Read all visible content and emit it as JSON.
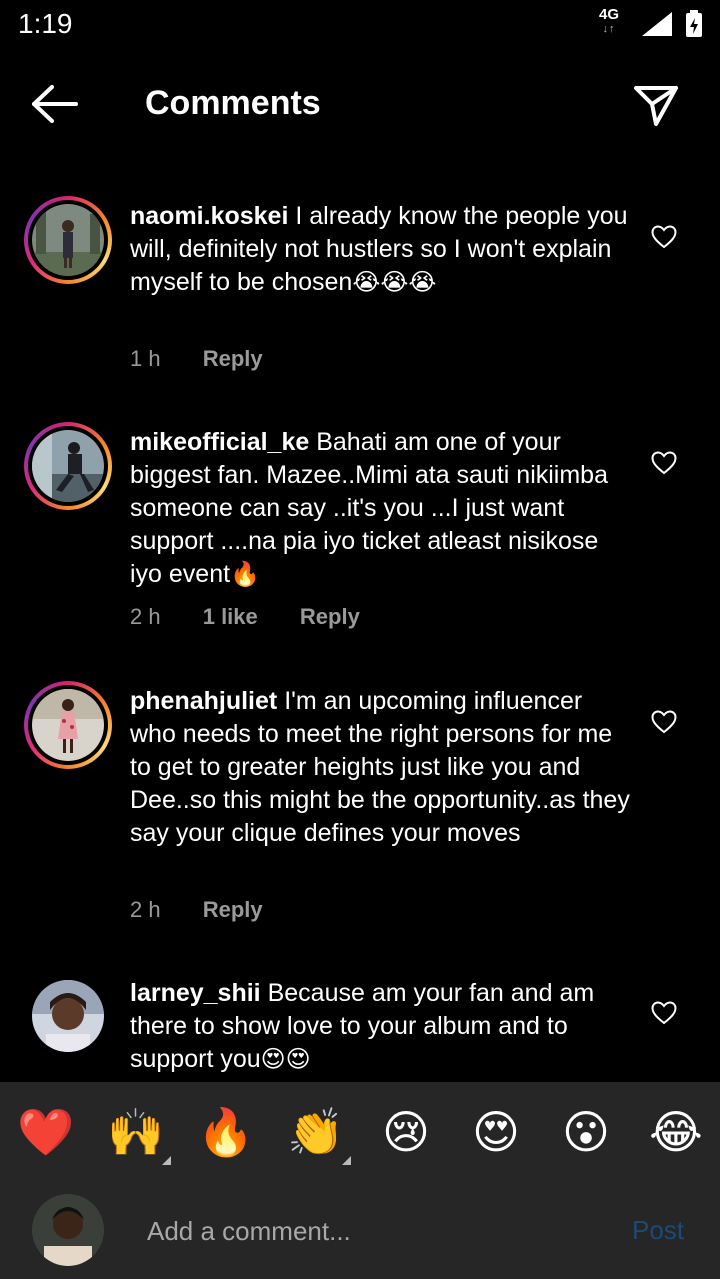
{
  "status": {
    "time": "1:19",
    "network": "4G"
  },
  "header": {
    "title": "Comments"
  },
  "comments": [
    {
      "username": "naomi.koskei",
      "text": "I already know the people you will, definitely not hustlers so I won't explain myself to be chosen",
      "emojis": "😭😭😭",
      "time": "1 h",
      "likes": "",
      "reply": "Reply"
    },
    {
      "username": "mikeofficial_ke",
      "text": "Bahati am one of your biggest fan. Mazee..Mimi ata sauti nikiimba someone can say ..it's you ...I just want support ....na pia iyo ticket atleast nisikose iyo event",
      "emojis": "🔥",
      "time": "2 h",
      "likes": "1 like",
      "reply": "Reply"
    },
    {
      "username": "phenahjuliet",
      "text": "I'm an upcoming influencer who needs to meet the right persons for me to get to greater heights just like you and Dee..so this might be the opportunity..as they say your clique defines your moves",
      "emojis": "",
      "time": "2 h",
      "likes": "",
      "reply": "Reply"
    },
    {
      "username": "larney_shii",
      "text": "Because am your fan and am there to show love to your album and to support you",
      "emojis": "😍😍",
      "time": "",
      "likes": "",
      "reply": ""
    }
  ],
  "reactions": [
    "❤️",
    "🙌",
    "🔥",
    "👏",
    "😢",
    "😍",
    "😮",
    "😂"
  ],
  "composer": {
    "placeholder": "Add a comment...",
    "post_label": "Post"
  },
  "colors": {
    "background": "#000000",
    "panel": "#262626",
    "muted": "#9a9a9a",
    "post_disabled": "#1c4a77"
  }
}
